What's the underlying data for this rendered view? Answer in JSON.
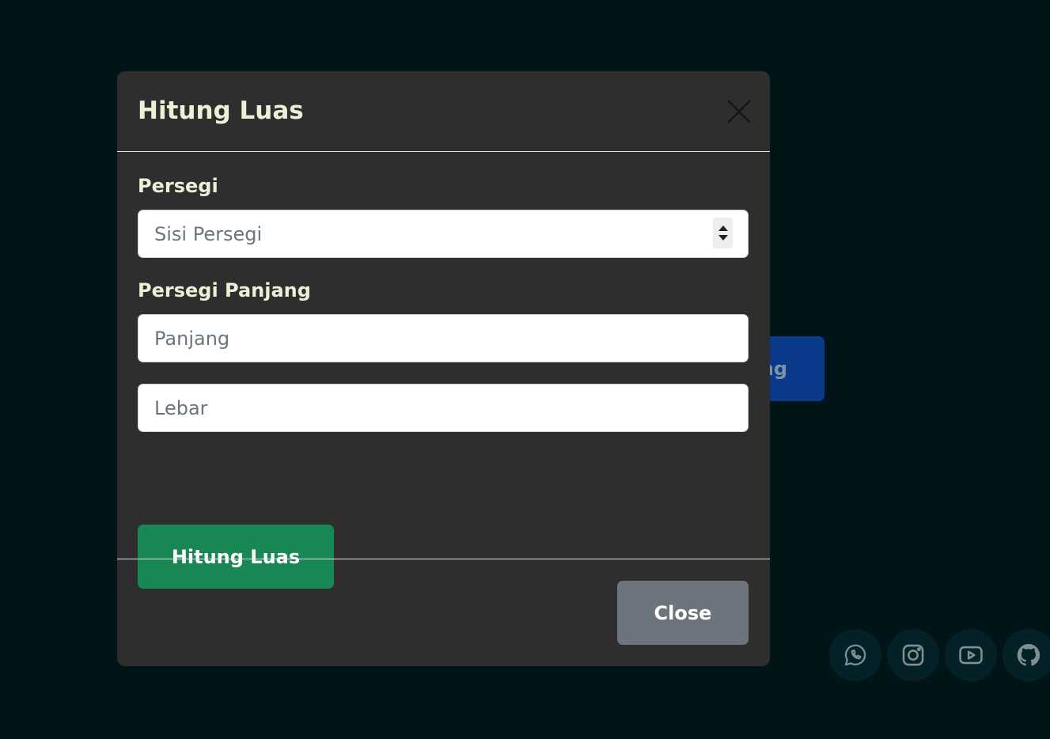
{
  "background": {
    "button_partial_text": "ng",
    "social_links": [
      {
        "icon": "whatsapp-icon"
      },
      {
        "icon": "instagram-icon"
      },
      {
        "icon": "youtube-icon"
      },
      {
        "icon": "github-icon"
      }
    ]
  },
  "modal": {
    "title": "Hitung Luas",
    "close_icon": "close-icon",
    "persegi": {
      "label": "Persegi",
      "placeholder": "Sisi Persegi",
      "value": ""
    },
    "persegi_panjang": {
      "label": "Persegi Panjang",
      "panjang_placeholder": "Panjang",
      "panjang_value": "",
      "lebar_placeholder": "Lebar",
      "lebar_value": ""
    },
    "submit_label": "Hitung Luas",
    "close_label": "Close"
  },
  "colors": {
    "page_background": "#011519",
    "modal_background": "#2e2e2e",
    "label_text": "#eef0d6",
    "submit_button": "#198754",
    "close_button": "#6c757d",
    "background_button": "#0b3a8a",
    "social_button": "#032126",
    "social_icon": "#7f8f93"
  }
}
